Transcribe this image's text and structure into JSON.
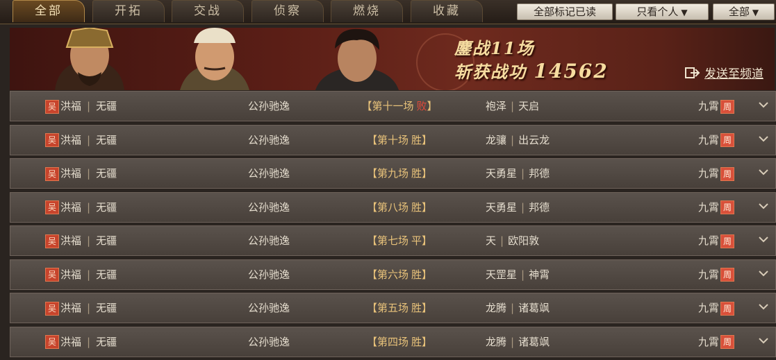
{
  "tabs": [
    {
      "label": "全部",
      "active": true
    },
    {
      "label": "开拓",
      "active": false
    },
    {
      "label": "交战",
      "active": false
    },
    {
      "label": "侦察",
      "active": false
    },
    {
      "label": "燃烧",
      "active": false
    },
    {
      "label": "收藏",
      "active": false
    }
  ],
  "toolbar": {
    "mark_all_read": "全部标记已读",
    "filter_personal": "只看个人",
    "filter_all": "全部"
  },
  "banner": {
    "battles_line": "鏖战11场",
    "merit_label": "斩获战功",
    "merit_value": "14562",
    "send_label": "发送至频道"
  },
  "rows": [
    {
      "faction": "吴",
      "player": "洪福",
      "alliance": "无疆",
      "commander": "公孙驰逸",
      "round": "第十一场",
      "result": "败",
      "result_type": "lose",
      "opp_alliance": "袍泽",
      "opp_player": "天启",
      "opp_side": "九霄",
      "opp_faction": "周"
    },
    {
      "faction": "吴",
      "player": "洪福",
      "alliance": "无疆",
      "commander": "公孙驰逸",
      "round": "第十场",
      "result": "胜",
      "result_type": "win",
      "opp_alliance": "龙骧",
      "opp_player": "出云龙",
      "opp_side": "九霄",
      "opp_faction": "周"
    },
    {
      "faction": "吴",
      "player": "洪福",
      "alliance": "无疆",
      "commander": "公孙驰逸",
      "round": "第九场",
      "result": "胜",
      "result_type": "win",
      "opp_alliance": "天勇星",
      "opp_player": "邦德",
      "opp_side": "九霄",
      "opp_faction": "周"
    },
    {
      "faction": "吴",
      "player": "洪福",
      "alliance": "无疆",
      "commander": "公孙驰逸",
      "round": "第八场",
      "result": "胜",
      "result_type": "win",
      "opp_alliance": "天勇星",
      "opp_player": "邦德",
      "opp_side": "九霄",
      "opp_faction": "周"
    },
    {
      "faction": "吴",
      "player": "洪福",
      "alliance": "无疆",
      "commander": "公孙驰逸",
      "round": "第七场",
      "result": "平",
      "result_type": "draw",
      "opp_alliance": "天",
      "opp_player": "欧阳敦",
      "opp_side": "九霄",
      "opp_faction": "周"
    },
    {
      "faction": "吴",
      "player": "洪福",
      "alliance": "无疆",
      "commander": "公孙驰逸",
      "round": "第六场",
      "result": "胜",
      "result_type": "win",
      "opp_alliance": "天罡星",
      "opp_player": "神霄",
      "opp_side": "九霄",
      "opp_faction": "周"
    },
    {
      "faction": "吴",
      "player": "洪福",
      "alliance": "无疆",
      "commander": "公孙驰逸",
      "round": "第五场",
      "result": "胜",
      "result_type": "win",
      "opp_alliance": "龙腾",
      "opp_player": "诸葛飒",
      "opp_side": "九霄",
      "opp_faction": "周"
    },
    {
      "faction": "吴",
      "player": "洪福",
      "alliance": "无疆",
      "commander": "公孙驰逸",
      "round": "第四场",
      "result": "胜",
      "result_type": "win",
      "opp_alliance": "龙腾",
      "opp_player": "诸葛飒",
      "opp_side": "九霄",
      "opp_faction": "周"
    }
  ]
}
